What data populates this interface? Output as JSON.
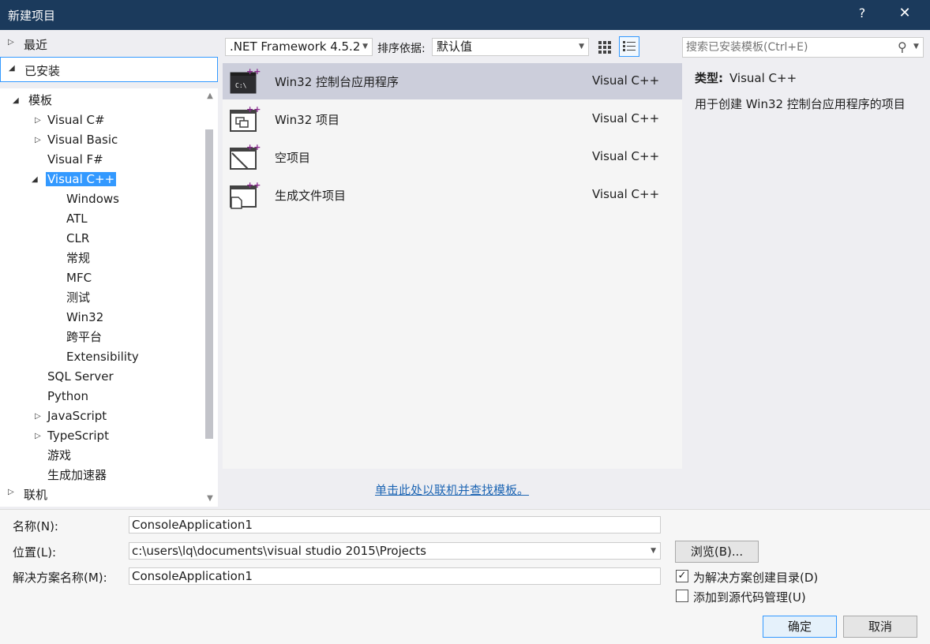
{
  "window": {
    "title": "新建项目",
    "help_label": "?",
    "close_label": "✕"
  },
  "left_nav": {
    "recent": "最近",
    "installed": "已安装",
    "online": "联机",
    "tree": [
      {
        "label": "模板",
        "expanded": true
      },
      {
        "label": "Visual C#",
        "expandable": true
      },
      {
        "label": "Visual Basic",
        "expandable": true
      },
      {
        "label": "Visual F#"
      },
      {
        "label": "Visual C++",
        "expanded": true,
        "selected": true
      },
      {
        "label": "Windows"
      },
      {
        "label": "ATL"
      },
      {
        "label": "CLR"
      },
      {
        "label": "常规"
      },
      {
        "label": "MFC"
      },
      {
        "label": "测试"
      },
      {
        "label": "Win32"
      },
      {
        "label": "跨平台"
      },
      {
        "label": "Extensibility"
      },
      {
        "label": "SQL Server"
      },
      {
        "label": "Python"
      },
      {
        "label": "JavaScript",
        "expandable": true
      },
      {
        "label": "TypeScript",
        "expandable": true
      },
      {
        "label": "游戏"
      },
      {
        "label": "生成加速器"
      }
    ]
  },
  "toolbar": {
    "framework": ".NET Framework 4.5.2",
    "sort_label": "排序依据:",
    "sort_value": "默认值",
    "search_placeholder": "搜索已安装模板(Ctrl+E)"
  },
  "templates": [
    {
      "name": "Win32 控制台应用程序",
      "language": "Visual C++",
      "icon": "console-app-icon",
      "selected": true
    },
    {
      "name": "Win32 项目",
      "language": "Visual C++",
      "icon": "win32-project-icon"
    },
    {
      "name": "空项目",
      "language": "Visual C++",
      "icon": "empty-project-icon"
    },
    {
      "name": "生成文件项目",
      "language": "Visual C++",
      "icon": "makefile-project-icon"
    }
  ],
  "online_link": "单击此处以联机并查找模板。",
  "description": {
    "type_label": "类型:",
    "type_value": "Visual C++",
    "text": "用于创建 Win32 控制台应用程序的项目"
  },
  "form": {
    "name_label": "名称(N):",
    "name_value": "ConsoleApplication1",
    "location_label": "位置(L):",
    "location_value": "c:\\users\\lq\\documents\\visual studio 2015\\Projects",
    "solution_label": "解决方案名称(M):",
    "solution_value": "ConsoleApplication1",
    "browse_label": "浏览(B)...",
    "create_dir_label": "为解决方案创建目录(D)",
    "create_dir_checked": true,
    "source_control_label": "添加到源代码管理(U)",
    "source_control_checked": false,
    "ok_label": "确定",
    "cancel_label": "取消"
  },
  "colors": {
    "titlebar": "#1b3a5c",
    "selection": "#3399ff",
    "template_selected": "#cccedb",
    "link": "#1e66b4",
    "plus_badge": "#8a2b8e"
  }
}
